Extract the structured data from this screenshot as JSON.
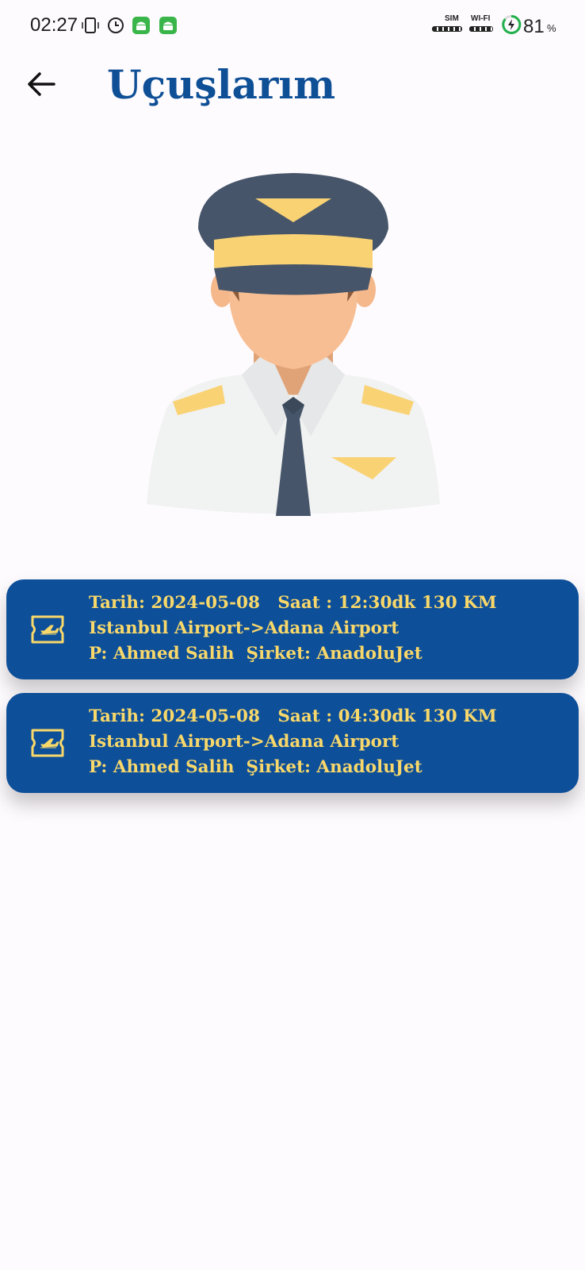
{
  "status_bar": {
    "time": "02:27",
    "sim_label": "SIM",
    "wifi_label": "WI-FI",
    "battery_percent": "81",
    "battery_unit": "%",
    "icons": [
      "vibrate-icon",
      "alarm-icon",
      "android-icon",
      "android-icon",
      "sim-signal-icon",
      "wifi-signal-icon",
      "battery-charging-icon"
    ]
  },
  "header": {
    "back_icon": "arrow-left-icon",
    "title": "Uçuşlarım"
  },
  "colors": {
    "title": "#0e4f96",
    "card_bg": "#0e4f99",
    "card_text": "#f8d86a",
    "background": "#fefbfe"
  },
  "flights": [
    {
      "icon": "flight-ticket-icon",
      "line1": "Tarih: 2024-05-08   Saat : 12:30dk 130 KM",
      "line2": "Istanbul Airport->Adana Airport",
      "line3": "P: Ahmed Salih  Şirket: AnadoluJet"
    },
    {
      "icon": "flight-ticket-icon",
      "line1": "Tarih: 2024-05-08   Saat : 04:30dk 130 KM",
      "line2": "Istanbul Airport->Adana Airport",
      "line3": "P: Ahmed Salih  Şirket: AnadoluJet"
    }
  ]
}
